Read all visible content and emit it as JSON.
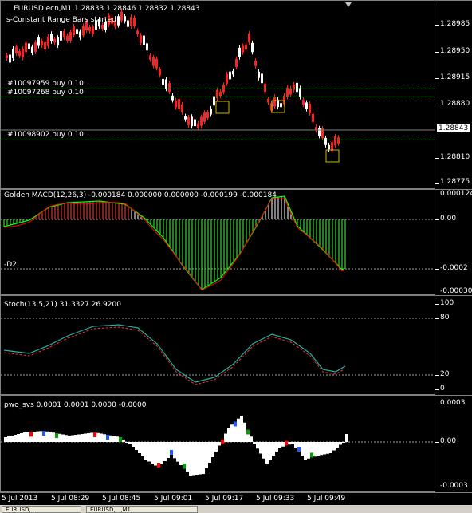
{
  "main_chart": {
    "title": "EURUSD.ecn,M1  1.28833 1.28846 1.28832 1.28843",
    "status": "s-Constant Range Bars started",
    "orders": [
      {
        "label": "#10097959 buy 0.10",
        "price": 1.289
      },
      {
        "label": "#10097268 buy 0.10",
        "price": 1.28886
      },
      {
        "label": "#10098902 buy 0.10",
        "price": 1.28834
      }
    ],
    "price_scale": [
      "1.28985",
      "1.28950",
      "1.28915",
      "1.28880",
      "1.28843",
      "1.28810",
      "1.28775"
    ],
    "current_price": "1.28843",
    "colors": {
      "bull": "#ffffff",
      "bear": "#ff2020",
      "order_line": "#00c000",
      "marker": "#c8b400"
    }
  },
  "macd": {
    "title": "Golden MACD(12,26,3) -0.000184 0.000000 0.000000 -0.000199 -0.000184",
    "level_label": "-D2",
    "scale": [
      "0.000124",
      "0.00",
      "-0.0002",
      "-0.000306"
    ],
    "colors": {
      "hist_up": "#ff4040",
      "hist_down": "#40ff40",
      "line_main": "#00ff00",
      "line_signal": "#ff0000"
    }
  },
  "stoch": {
    "title": "Stoch(13,5,21) 31.3327 26.9200",
    "scale": [
      "100",
      "80",
      "20",
      "0"
    ],
    "colors": {
      "main": "#20b2aa",
      "signal": "#ff3030"
    }
  },
  "pwo": {
    "title": "pwo_svs 0.0001 0.0001 0.0000 -0.0000",
    "scale": [
      "0.0003",
      "0.00",
      "-0.0003"
    ],
    "colors": {
      "white": "#ffffff",
      "red": "#ff0000",
      "blue": "#1e5aff",
      "green": "#00a000"
    }
  },
  "time_axis": [
    "5 Jul 2013",
    "5 Jul 08:29",
    "5 Jul 08:45",
    "5 Jul 09:01",
    "5 Jul 09:17",
    "5 Jul 09:33",
    "5 Jul 09:49"
  ],
  "tabs": [
    "EURUSD,...",
    "EURUSD,...,M1"
  ]
}
